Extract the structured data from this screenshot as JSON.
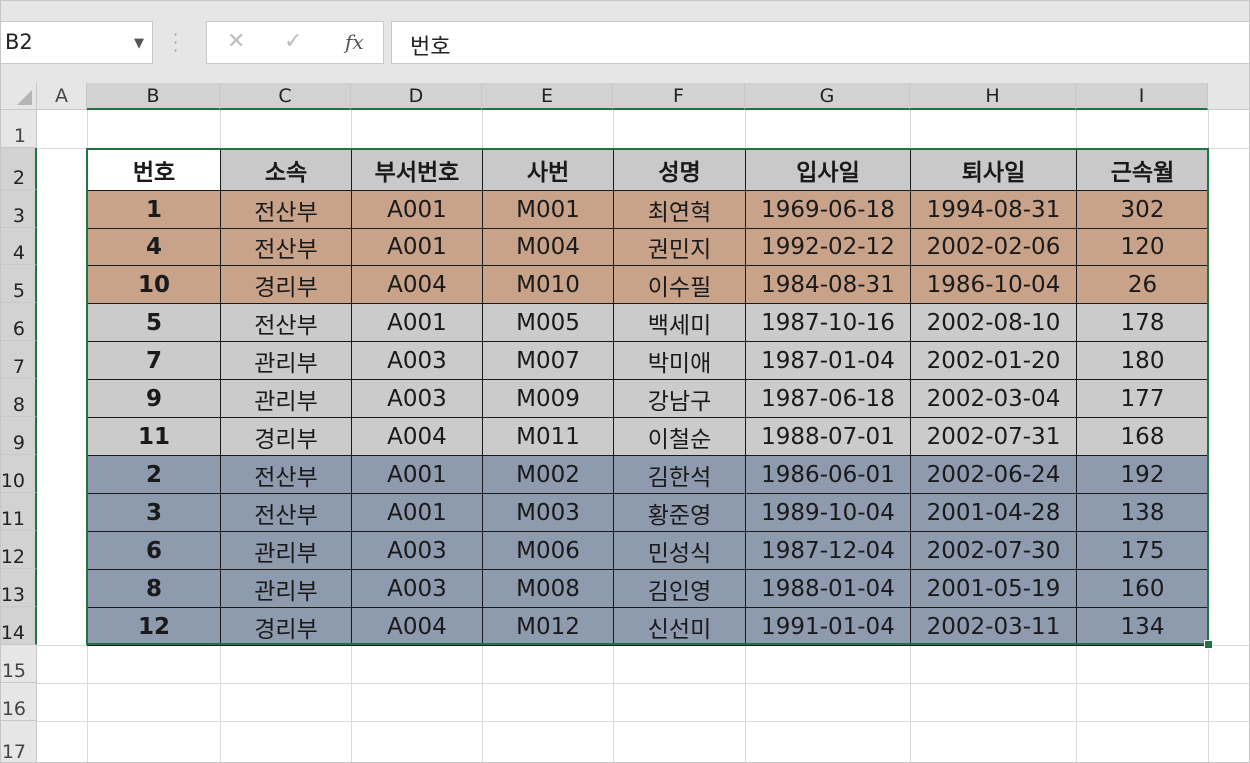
{
  "name_box": {
    "value": "B2"
  },
  "formula_bar": {
    "value": "번호",
    "cancel_glyph": "✕",
    "enter_glyph": "✓",
    "fx_label": "fx"
  },
  "columns": [
    "A",
    "B",
    "C",
    "D",
    "E",
    "F",
    "G",
    "H",
    "I"
  ],
  "rows": [
    "1",
    "2",
    "3",
    "4",
    "5",
    "6",
    "7",
    "8",
    "9",
    "10",
    "11",
    "12",
    "13",
    "14",
    "15",
    "16",
    "17"
  ],
  "table": {
    "headers": [
      "번호",
      "소속",
      "부서번호",
      "사번",
      "성명",
      "입사일",
      "퇴사일",
      "근속월"
    ],
    "rows": [
      [
        "1",
        "전산부",
        "A001",
        "M001",
        "최연혁",
        "1969-06-18",
        "1994-08-31",
        "302"
      ],
      [
        "4",
        "전산부",
        "A001",
        "M004",
        "권민지",
        "1992-02-12",
        "2002-02-06",
        "120"
      ],
      [
        "10",
        "경리부",
        "A004",
        "M010",
        "이수필",
        "1984-08-31",
        "1986-10-04",
        "26"
      ],
      [
        "5",
        "전산부",
        "A001",
        "M005",
        "백세미",
        "1987-10-16",
        "2002-08-10",
        "178"
      ],
      [
        "7",
        "관리부",
        "A003",
        "M007",
        "박미애",
        "1987-01-04",
        "2002-01-20",
        "180"
      ],
      [
        "9",
        "관리부",
        "A003",
        "M009",
        "강남구",
        "1987-06-18",
        "2002-03-04",
        "177"
      ],
      [
        "11",
        "경리부",
        "A004",
        "M011",
        "이철순",
        "1988-07-01",
        "2002-07-31",
        "168"
      ],
      [
        "2",
        "전산부",
        "A001",
        "M002",
        "김한석",
        "1986-06-01",
        "2002-06-24",
        "192"
      ],
      [
        "3",
        "전산부",
        "A001",
        "M003",
        "황준영",
        "1989-10-04",
        "2001-04-28",
        "138"
      ],
      [
        "6",
        "관리부",
        "A003",
        "M006",
        "민성식",
        "1987-12-04",
        "2002-07-30",
        "175"
      ],
      [
        "8",
        "관리부",
        "A003",
        "M008",
        "김인영",
        "1988-01-04",
        "2001-05-19",
        "160"
      ],
      [
        "12",
        "경리부",
        "A004",
        "M012",
        "신선미",
        "1991-01-04",
        "2002-03-11",
        "134"
      ]
    ],
    "row_groups": [
      "brown",
      "brown",
      "brown",
      "gray",
      "gray",
      "gray",
      "gray",
      "blue",
      "blue",
      "blue",
      "blue",
      "blue"
    ]
  },
  "colors": {
    "brown": "#c8a38a",
    "gray": "#cbcbcb",
    "blue": "#8e9aae",
    "selection": "#217346"
  }
}
